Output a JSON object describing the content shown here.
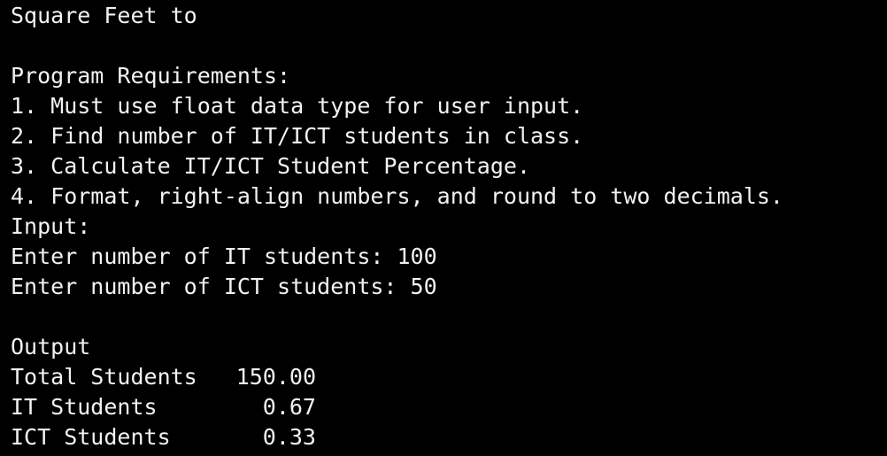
{
  "console": {
    "title_line": "Square Feet to",
    "requirements_heading": "Program Requirements:",
    "requirements": [
      "1. Must use float data type for user input.",
      "2. Find number of IT/ICT students in class.",
      "3. Calculate IT/ICT Student Percentage.",
      "4. Format, right-align numbers, and round to two decimals."
    ],
    "input_heading": "Input:",
    "input_it_prompt": "Enter number of IT students: ",
    "input_it_value": "100",
    "input_ict_prompt": "Enter number of ICT students: ",
    "input_ict_value": "50",
    "output_heading": "Output",
    "output_rows": [
      {
        "label": "Total Students",
        "value": "150.00"
      },
      {
        "label": "IT Students",
        "value": "0.67"
      },
      {
        "label": "ICT Students",
        "value": "0.33"
      }
    ]
  }
}
